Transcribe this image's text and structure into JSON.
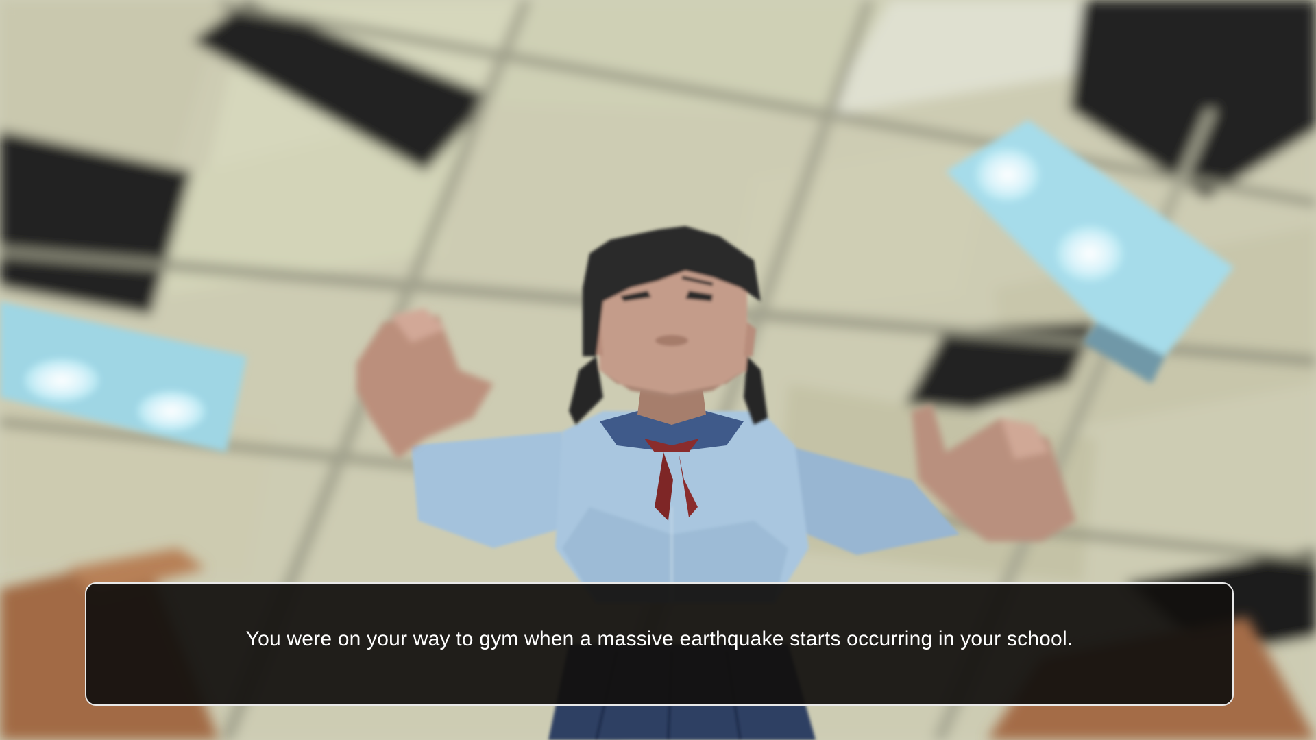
{
  "dialogue": {
    "text": "You were on your way to gym when a massive earthquake starts occurring in your school."
  },
  "scene": {
    "description_icon": "shaking-student-character",
    "palette": {
      "ceiling_tile": "#cfceb4",
      "ceiling_gap": "#222222",
      "ceiling_light": "#aee3ef",
      "shirt": "#a9c6df",
      "collar": "#3f5a8a",
      "ribbon": "#8a2c2c",
      "skin": "#c9a08e",
      "hair": "#2a2a2a",
      "skirt": "#2f3f63",
      "desk": "#a8704c"
    }
  }
}
